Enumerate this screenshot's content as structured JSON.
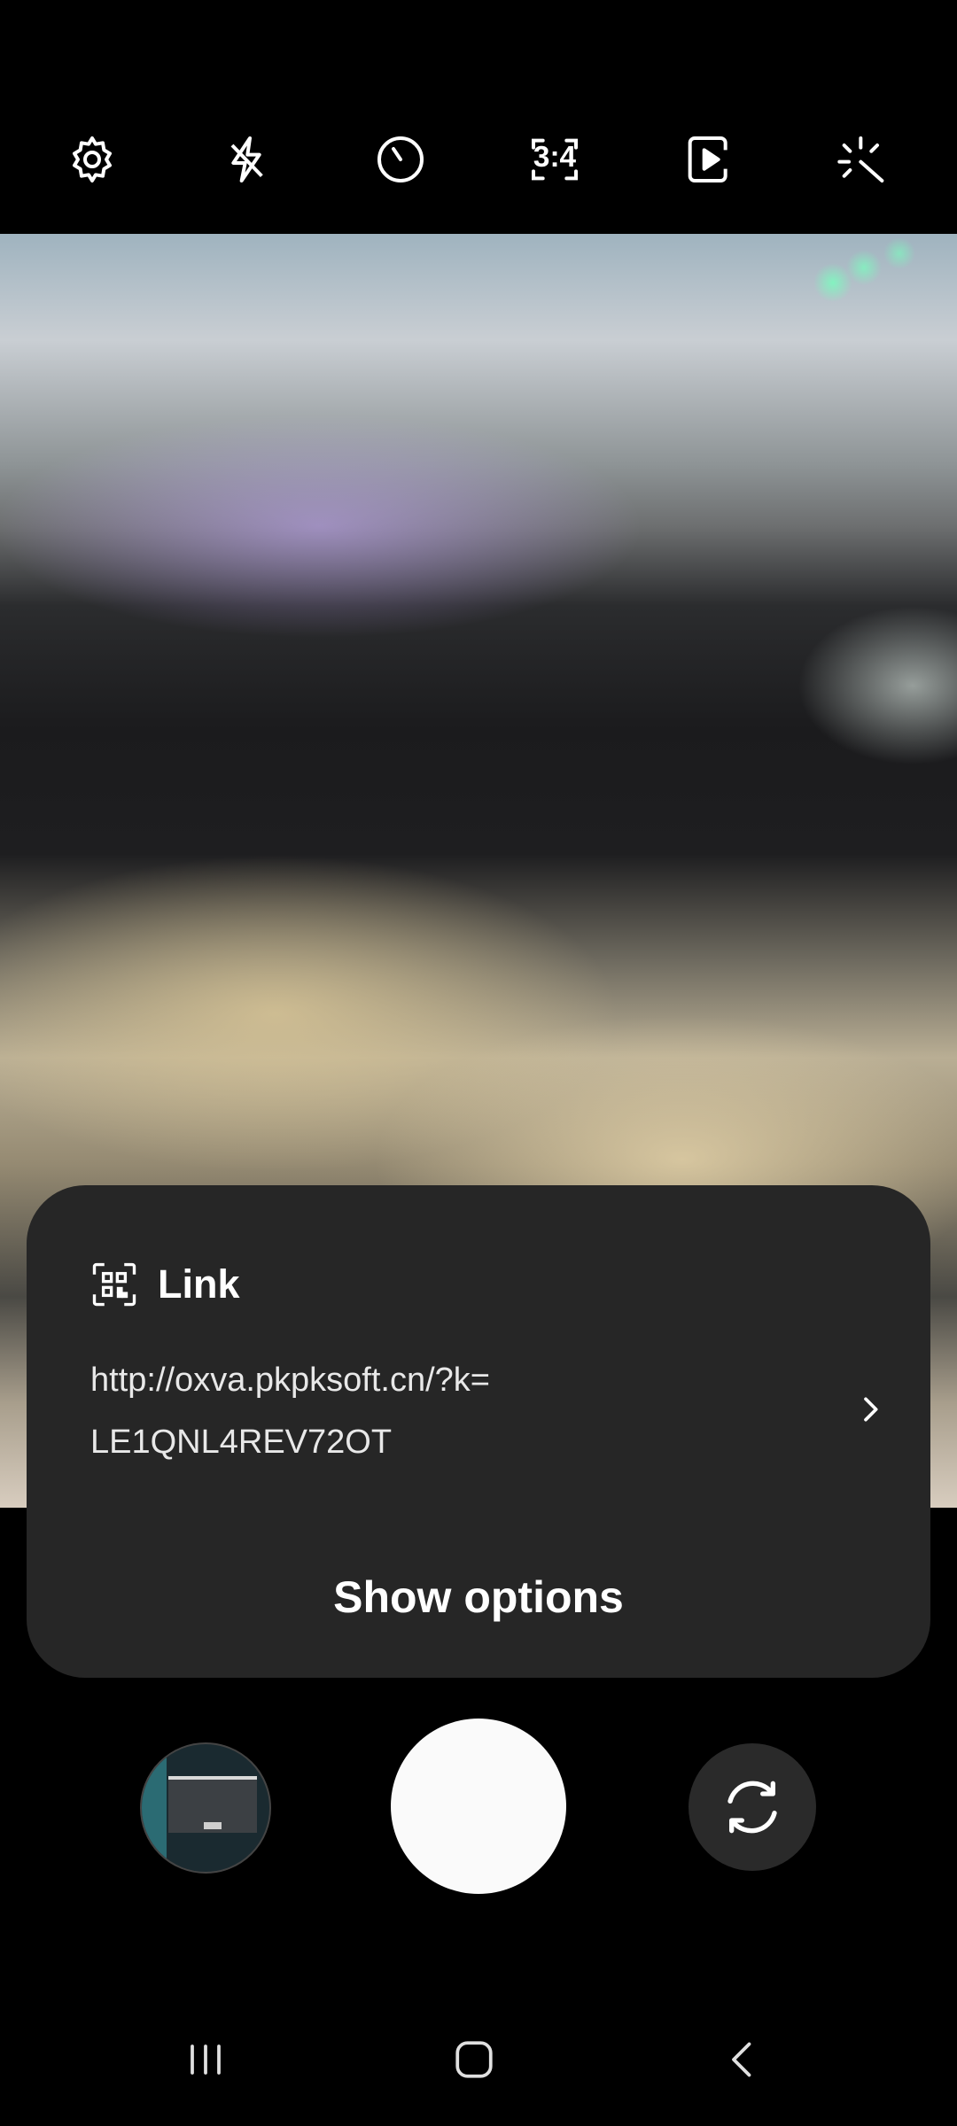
{
  "toolbar": {
    "items": [
      {
        "name": "settings-icon"
      },
      {
        "name": "flash-off-icon"
      },
      {
        "name": "timer-icon"
      },
      {
        "name": "aspect-ratio-icon",
        "label": "3:4"
      },
      {
        "name": "motion-photo-icon"
      },
      {
        "name": "filters-icon"
      }
    ]
  },
  "qr_card": {
    "icon": "qr-code-icon",
    "title": "Link",
    "link_text": "http://oxva.pkpksoft.cn/?k=​LE1QNL4REV72OT",
    "link_line1": "http://oxva.pkpksoft.cn/?k=",
    "link_line2": "LE1QNL4REV72OT",
    "action_label": "Show options"
  },
  "controls": {
    "gallery": "gallery-thumbnail",
    "shutter": "shutter-button",
    "switch_camera": "switch-camera-icon"
  },
  "navbar": {
    "recents": "recents-icon",
    "home": "home-icon",
    "back": "back-icon"
  },
  "colors": {
    "background": "#000000",
    "card": "#262626",
    "shutter": "#fafafa",
    "flip_button": "#2a2a2a"
  }
}
